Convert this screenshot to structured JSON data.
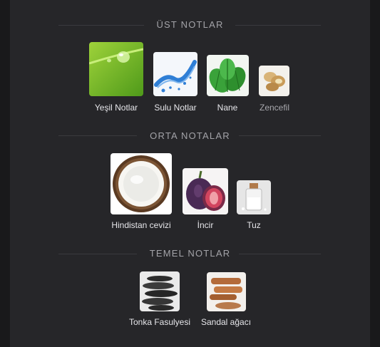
{
  "sections": [
    {
      "title": "ÜST NOTLAR",
      "notes": [
        {
          "label": "Yeşil Notlar",
          "icon": "green-leaf-dewdrop-icon"
        },
        {
          "label": "Sulu Notlar",
          "icon": "water-splash-icon"
        },
        {
          "label": "Nane",
          "icon": "mint-leaves-icon"
        },
        {
          "label": "Zencefil",
          "icon": "ginger-root-icon"
        }
      ]
    },
    {
      "title": "ORTA NOTALAR",
      "notes": [
        {
          "label": "Hindistan cevizi",
          "icon": "coconut-icon"
        },
        {
          "label": "İncir",
          "icon": "fig-icon"
        },
        {
          "label": "Tuz",
          "icon": "salt-jar-icon"
        }
      ]
    },
    {
      "title": "TEMEL NOTLAR",
      "notes": [
        {
          "label": "Tonka Fasulyesi",
          "icon": "tonka-bean-icon"
        },
        {
          "label": "Sandal ağacı",
          "icon": "sandalwood-icon"
        }
      ]
    }
  ]
}
